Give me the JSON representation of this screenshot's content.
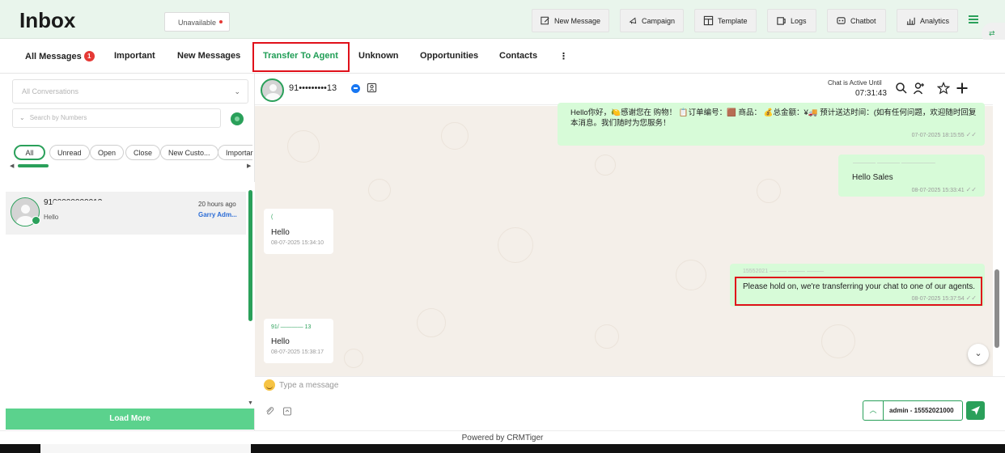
{
  "header": {
    "title": "Inbox",
    "status": "Unavailable",
    "buttons": [
      {
        "label": "New Message",
        "icon": "new-message-icon"
      },
      {
        "label": "Campaign",
        "icon": "campaign-icon"
      },
      {
        "label": "Template",
        "icon": "template-icon"
      },
      {
        "label": "Logs",
        "icon": "logs-icon"
      },
      {
        "label": "Chatbot",
        "icon": "chatbot-icon"
      },
      {
        "label": "Analytics",
        "icon": "analytics-icon"
      }
    ],
    "corner_widget": "⇄"
  },
  "tabs": {
    "all_messages": "All Messages",
    "all_messages_badge": "1",
    "important": "Important",
    "new_messages": "New Messages",
    "transfer_to_agent": "Transfer To Agent",
    "unknown": "Unknown",
    "opportunities": "Opportunities",
    "contacts": "Contacts",
    "more": "⋮"
  },
  "sidebar": {
    "conversation_filter": "All Conversations",
    "search_placeholder": "Search by Numbers",
    "pills": [
      "All",
      "Unread",
      "Open",
      "Close",
      "New Custo...",
      "Importar"
    ],
    "conversation": {
      "name": "9100000000013",
      "last_message": "Hello",
      "time": "20 hours ago",
      "agent": "Garry Adm..."
    },
    "load_more": "Load More"
  },
  "chat": {
    "contact": "91•••••••••13",
    "active_label": "Chat is Active Until",
    "active_time": "07:31:43",
    "messages": {
      "m1_text": "Hello你好，🍋感谢您在 购物！ 📋订单编号：🟫 商品： 💰总金额：¥🚚 预计送达时间：(如有任何问题，欢迎随时回复本消息。我们随时为您服务！",
      "m1_time": "07-07-2025 18:15:55",
      "m2_sender": "———— ———— ——————",
      "m2_text": "Hello Sales",
      "m2_time": "08-07-2025 15:33:41",
      "m3_sender": "(",
      "m3_text": "Hello",
      "m3_time": "08-07-2025 15:34:10",
      "m4_sender": "15552021 ——— ——— ———",
      "m4_text": "Please hold on, we're transferring your chat to one of our agents.",
      "m4_time": "08-07-2025 15:37:54",
      "m5_sender": "91/ ———— 13",
      "m5_text": "Hello",
      "m5_time": "08-07-2025 15:38:17"
    }
  },
  "composer": {
    "placeholder": "Type a message",
    "agent": "admin - 15552021000"
  },
  "footer": "Powered by CRMTiger",
  "colors": {
    "accent": "#2aa05a",
    "highlight": "#e0101a",
    "chat_background": "#f4efe9",
    "outgoing_bubble": "#d7fbd8"
  }
}
